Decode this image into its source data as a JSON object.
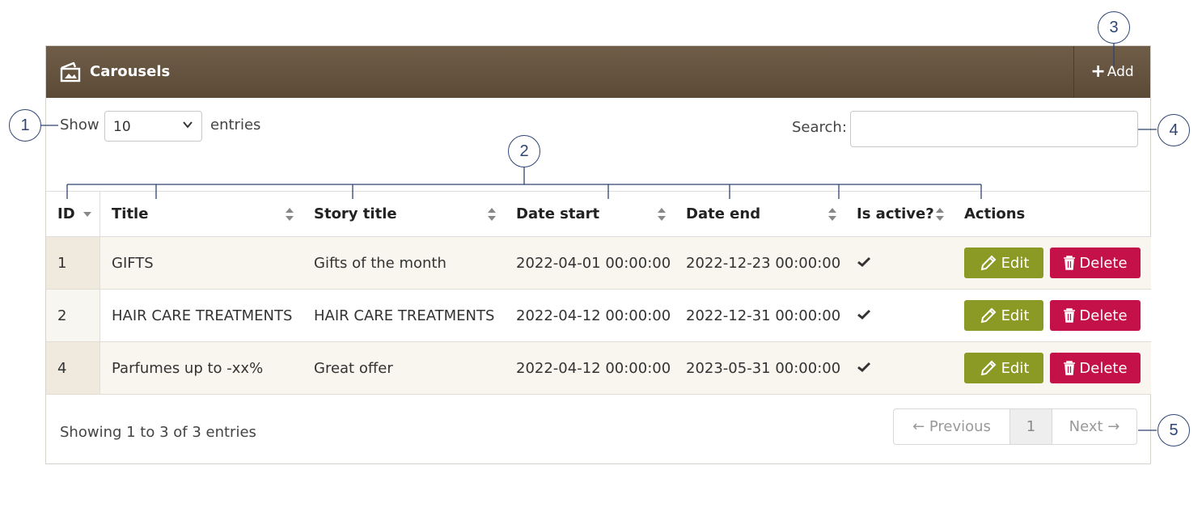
{
  "panel": {
    "title": "Carousels",
    "add_label": "Add"
  },
  "length_control": {
    "show_label": "Show",
    "value": "10",
    "entries_label": "entries"
  },
  "search": {
    "label": "Search:",
    "value": "",
    "placeholder": ""
  },
  "table": {
    "columns": [
      "ID",
      "Title",
      "Story title",
      "Date start",
      "Date end",
      "Is active?",
      "Actions"
    ],
    "rows": [
      {
        "id": "1",
        "title": "GIFTS",
        "story_title": "Gifts of the month",
        "date_start": "2022-04-01 00:00:00",
        "date_end": "2022-12-23 00:00:00",
        "active": true
      },
      {
        "id": "2",
        "title": "HAIR CARE TREATMENTS",
        "story_title": "HAIR CARE TREATMENTS",
        "date_start": "2022-04-12 00:00:00",
        "date_end": "2022-12-31 00:00:00",
        "active": true
      },
      {
        "id": "4",
        "title": "Parfumes up to -xx%",
        "story_title": "Great offer",
        "date_start": "2022-04-12 00:00:00",
        "date_end": "2023-05-31 00:00:00",
        "active": true
      }
    ],
    "edit_label": "Edit",
    "delete_label": "Delete"
  },
  "footer": {
    "info": "Showing 1 to 3 of 3 entries",
    "pagination": {
      "previous": "← Previous",
      "page": "1",
      "next": "Next →"
    }
  },
  "callouts": [
    "1",
    "2",
    "3",
    "4",
    "5"
  ],
  "colors": {
    "header": "#6a5841",
    "edit": "#8a9a24",
    "delete": "#c4114a",
    "callout": "#2f4574"
  },
  "icons": {
    "header": "carousel-icon",
    "add": "plus-icon",
    "edit": "pencil-icon",
    "delete": "trash-icon",
    "active": "checkmark-icon",
    "select": "chevron-down-icon",
    "sort": "sort-icon"
  }
}
